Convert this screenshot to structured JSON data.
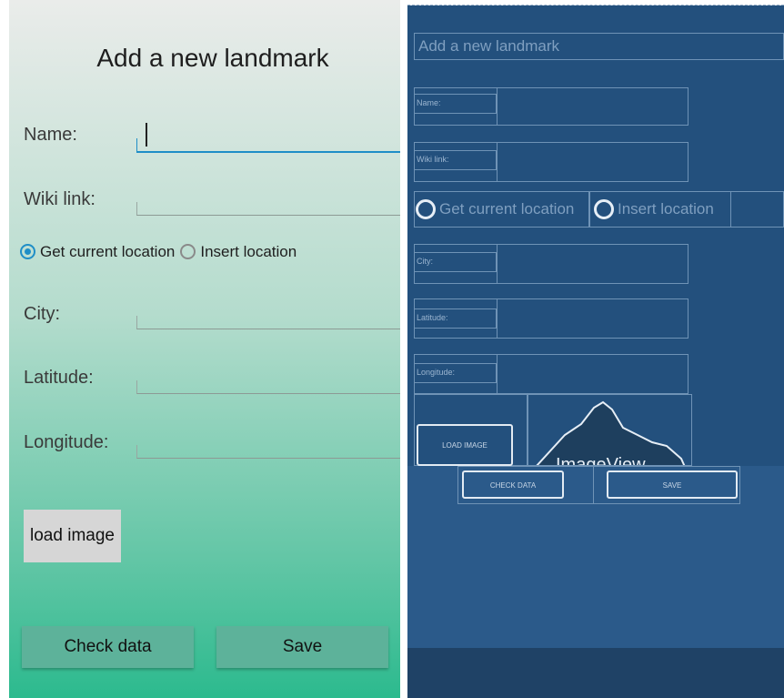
{
  "form": {
    "title": "Add a new landmark",
    "name_label": "Name:",
    "name_value": "",
    "wiki_label": "Wiki link:",
    "radio_current": "Get current location",
    "radio_insert": "Insert location",
    "radio_selected": "Get current location",
    "city_label": "City:",
    "latitude_label": "Latitude:",
    "longitude_label": "Longitude:",
    "load_image": "load image",
    "check_data": "Check data",
    "save": "Save"
  },
  "blueprint": {
    "title": "Add a new landmark",
    "name": "Name:",
    "wiki": "Wiki link:",
    "radio_current": "Get current location",
    "radio_insert": "Insert location",
    "city": "City:",
    "latitude": "Latitude:",
    "longitude": "Longitude:",
    "load_image": "LOAD IMAGE",
    "imageview": "ImageView",
    "check_data": "CHECK DATA",
    "save": "SAVE"
  },
  "colors": {
    "accent": "#1f8ec7",
    "button": "#5db29a",
    "blueprint_bg": "#23507d"
  }
}
